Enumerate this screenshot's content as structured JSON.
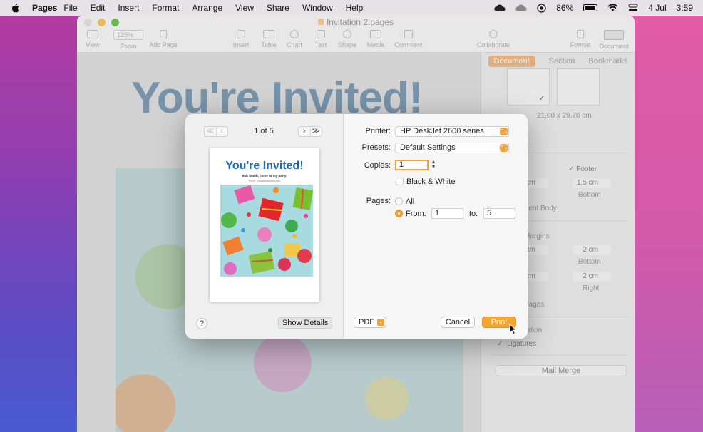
{
  "menubar": {
    "app_name": "Pages",
    "items": [
      "File",
      "Edit",
      "Insert",
      "Format",
      "Arrange",
      "View",
      "Share",
      "Window",
      "Help"
    ],
    "battery": "86%",
    "date": "4 Jul",
    "time": "3:59"
  },
  "window": {
    "title": "Invitation 2.pages",
    "toolbar": {
      "view": "View",
      "zoom_value": "125%",
      "zoom": "Zoom",
      "add_page": "Add Page",
      "insert": "Insert",
      "table": "Table",
      "chart": "Chart",
      "text": "Text",
      "shape": "Shape",
      "media": "Media",
      "comment": "Comment",
      "collaborate": "Collaborate",
      "format": "Format",
      "document": "Document"
    },
    "doc_heading": "You're Invited!"
  },
  "sidebar": {
    "tabs": [
      "Document",
      "Section",
      "Bookmarks"
    ],
    "paper_size": "21.00 x 29.70 cm",
    "footer_label": "Footer",
    "header_value_partial": "5 cm",
    "footer_value": "1.5 cm",
    "top_partial": "p",
    "bottom_label": "Bottom",
    "document_body_partial": "ment Body",
    "margins_partial": "Margins",
    "top_margin_partial": "2 cm",
    "bottom_margin": "2 cm",
    "top_caption_partial": "p",
    "bottom_caption": "Bottom",
    "left_margin_partial": "2 cm",
    "right_margin": "2 cm",
    "left_caption_partial": "t",
    "right_caption": "Right",
    "pages_partial": "Pages",
    "hyphenation_partial": "nation",
    "ligatures": "Ligatures",
    "mail_merge": "Mail Merge",
    "check": "✓"
  },
  "print_dialog": {
    "page_indicator": "1 of 5",
    "nav_first": "≪",
    "nav_prev": "‹",
    "nav_next": "›",
    "nav_last": "≫",
    "preview": {
      "title": "You're Invited!",
      "subtitle": "Bob Smith, come to my party!",
      "rsvp": "RSVP · rsvp@bobsmith.com"
    },
    "help": "?",
    "show_details": "Show Details",
    "printer_label": "Printer:",
    "printer_value": "HP DeskJet 2600 series",
    "presets_label": "Presets:",
    "presets_value": "Default Settings",
    "copies_label": "Copies:",
    "copies_value": "1",
    "black_white_label": "Black & White",
    "pages_label": "Pages:",
    "all_label": "All",
    "from_label": "From:",
    "from_value": "1",
    "to_label": "to:",
    "to_value": "5",
    "pdf": "PDF",
    "cancel": "Cancel",
    "print": "Print",
    "popup_arrow": "⌃⌄",
    "accent": "#f6a530"
  }
}
